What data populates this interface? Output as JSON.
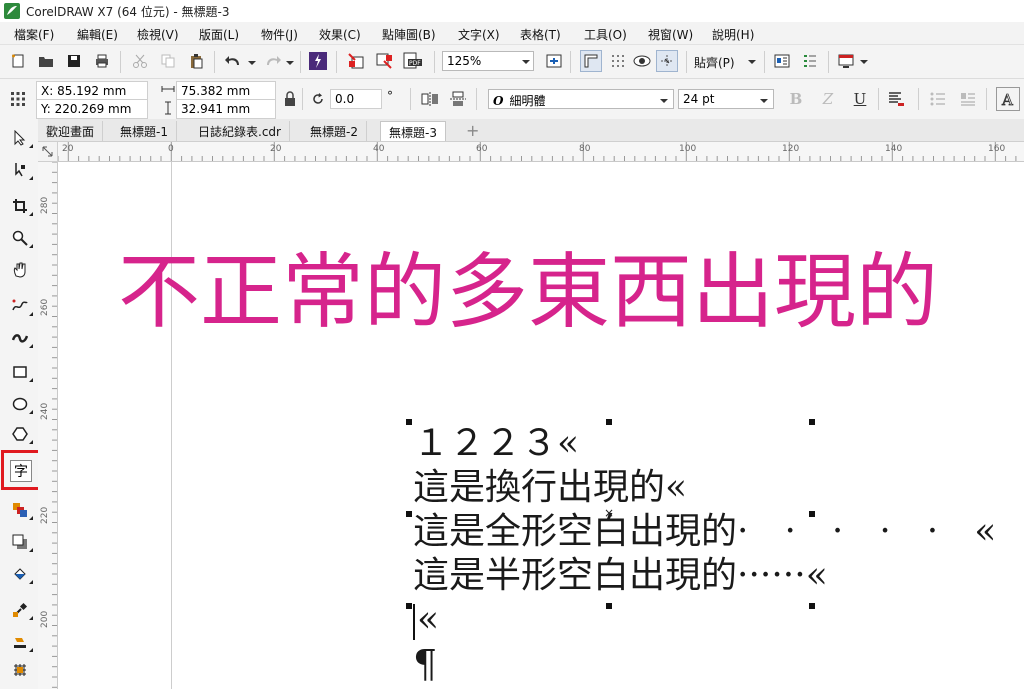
{
  "window": {
    "title": "CorelDRAW X7 (64 位元) - 無標題-3"
  },
  "menu": [
    "檔案(F)",
    "編輯(E)",
    "檢視(V)",
    "版面(L)",
    "物件(J)",
    "效果(C)",
    "點陣圖(B)",
    "文字(X)",
    "表格(T)",
    "工具(O)",
    "視窗(W)",
    "說明(H)"
  ],
  "toolbar": {
    "zoom": "125%",
    "snap": "貼齊(P)"
  },
  "property_bar": {
    "x": "X: 85.192 mm",
    "y": "Y: 220.269 mm",
    "width": "75.382 mm",
    "height": "32.941 mm",
    "rotation": "0.0",
    "degree_symbol": "°",
    "font_name": "細明體",
    "font_size": "24 pt"
  },
  "tabs": [
    "歡迎畫面",
    "無標題-1",
    "日誌紀錄表.cdr",
    "無標題-2",
    "無標題-3"
  ],
  "ruler": {
    "h_labels": [
      "20",
      "0",
      "20",
      "40",
      "60",
      "80",
      "100",
      "120",
      "140",
      "160"
    ],
    "v_labels": [
      "280",
      "260",
      "240",
      "220",
      "200"
    ]
  },
  "tool_text_label": "字",
  "canvas": {
    "headline": "不正常的多東西出現的",
    "headline_color": "#d6248c",
    "lines": [
      {
        "text": "１２２３",
        "mark": "«"
      },
      {
        "text": "這是換行出現的",
        "mark": "«"
      },
      {
        "text": "這是全形空白出現的",
        "spaces": "·　·　·　·　·　",
        "mark": "«"
      },
      {
        "text": "這是半形空白出現的",
        "spaces": "······",
        "mark": "«"
      },
      {
        "text": "",
        "mark": "«"
      }
    ],
    "pilcrow": "¶",
    "center_mark": "×"
  }
}
